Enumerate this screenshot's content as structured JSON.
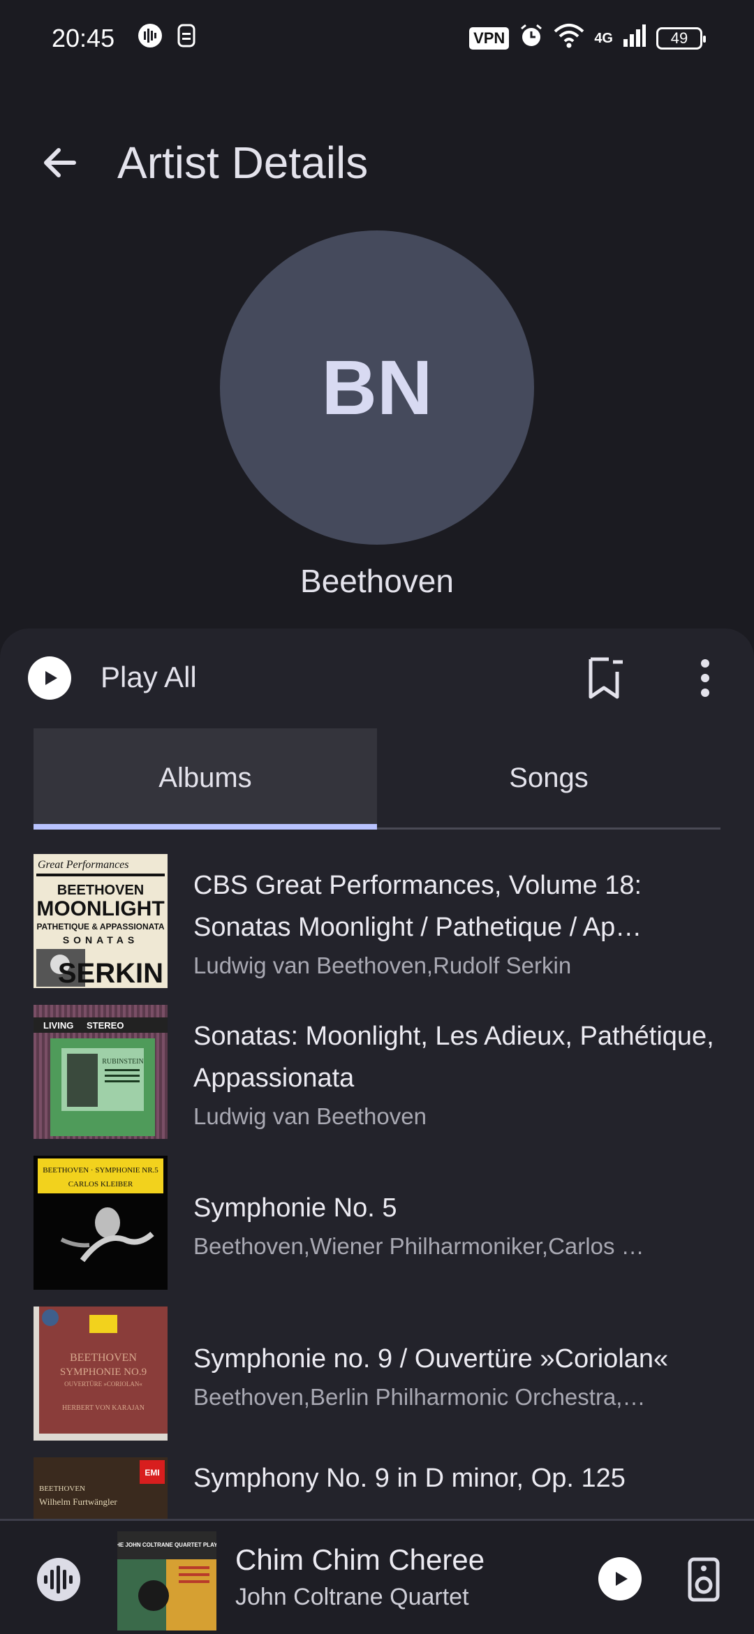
{
  "status_bar": {
    "time": "20:45",
    "vpn": "VPN",
    "network": "4G",
    "battery": "49",
    "icons": [
      "podcast-icon",
      "sim-icon",
      "alarm-icon",
      "wifi-icon",
      "signal-icon"
    ]
  },
  "app_bar": {
    "title": "Artist Details",
    "back_icon": "arrow-left-icon"
  },
  "artist": {
    "initials": "BN",
    "name": "Beethoven"
  },
  "actions": {
    "play_all": "Play All",
    "play_icon": "play-icon",
    "bookmark_icon": "bookmark-icon",
    "more_icon": "more-vertical-icon"
  },
  "tabs": [
    {
      "label": "Albums",
      "active": true
    },
    {
      "label": "Songs",
      "active": false
    }
  ],
  "albums": [
    {
      "title": "CBS Great Performances, Volume 18: Sonatas Moonlight / Pathetique / Ap…",
      "artist": "Ludwig van Beethoven,Rudolf Serkin",
      "cover_text": [
        "Great Performances",
        "BEETHOVEN",
        "MOONLIGHT",
        "PATHETIQUE & APPASSIONATA",
        "SONATAS",
        "SERKIN"
      ]
    },
    {
      "title": "Sonatas: Moonlight, Les Adieux, Pathétique, Appassionata",
      "artist": "Ludwig van Beethoven",
      "cover_text": [
        "LIVING",
        "STEREO",
        "RUBINSTEIN"
      ]
    },
    {
      "title": "Symphonie No. 5",
      "artist": "Beethoven,Wiener Philharmoniker,Carlos …",
      "cover_text": [
        "BEETHOVEN · SYMPHONIE NR.5",
        "CARLOS KLEIBER"
      ]
    },
    {
      "title": "Symphonie no. 9 / Ouvertüre »Coriolan«",
      "artist": "Beethoven,Berlin Philharmonic Orchestra,…",
      "cover_text": [
        "BEETHOVEN",
        "SYMPHONIE NO.9",
        "OUVERTÜRE »CORIOLAN«",
        "HERBERT VON KARAJAN"
      ]
    },
    {
      "title": "Symphony No. 9 in D minor, Op. 125",
      "artist": "",
      "cover_text": [
        "BEETHOVEN",
        "Wilhelm Furtwängler",
        "EMI"
      ]
    }
  ],
  "now_playing": {
    "title": "Chim Chim Cheree",
    "artist": "John Coltrane Quartet",
    "cover_text": [
      "THE JOHN COLTRANE QUARTET PLAYS"
    ],
    "wave_icon": "audio-wave-icon",
    "play_icon": "play-icon",
    "speaker_icon": "speaker-icon"
  },
  "colors": {
    "background": "#1b1b21",
    "sheet": "#23232b",
    "avatar": "#454a5c",
    "tab_indicator": "#b9c3ff"
  }
}
